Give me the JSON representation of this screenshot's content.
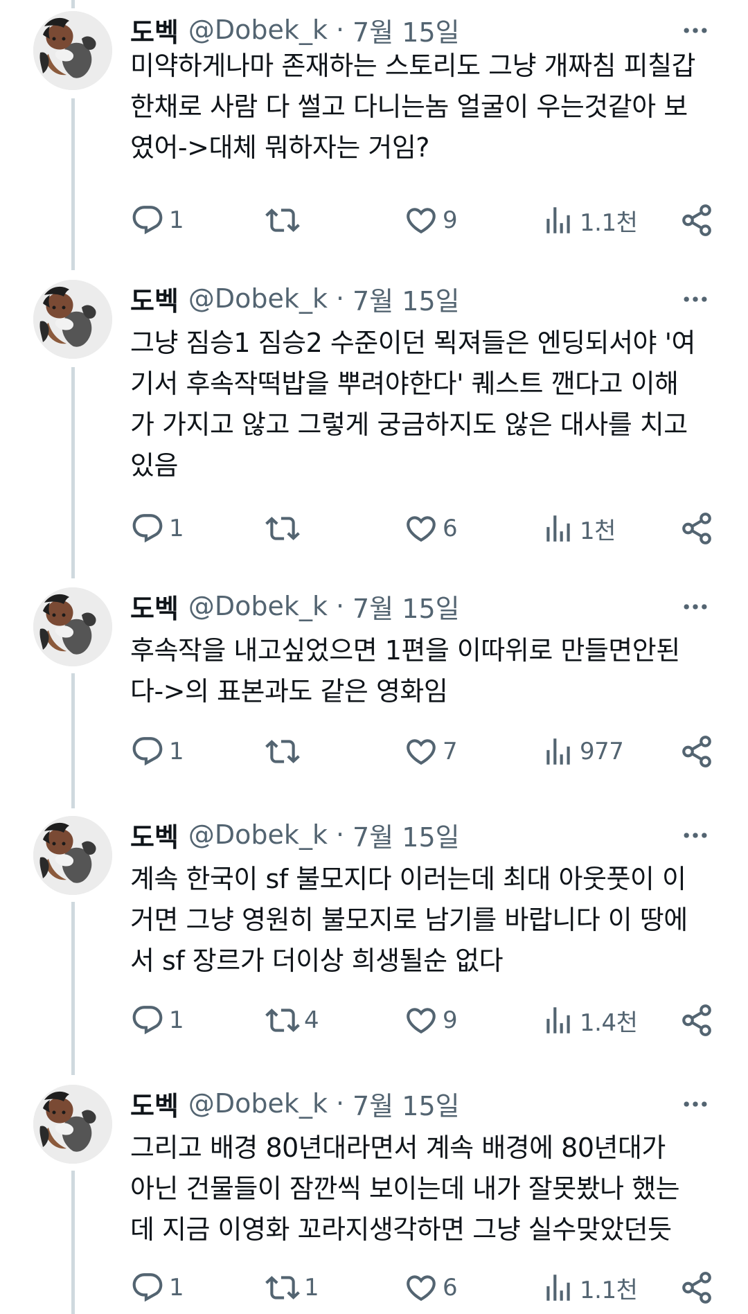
{
  "thread": {
    "tweets": [
      {
        "name": "도벡",
        "handle": "@Dobek_k",
        "separator": "·",
        "date": "7월 15일",
        "text": "미약하게나마 존재하는 스토리도 그냥 개짜침 피칠갑\n한채로 사람 다 썰고 다니는놈 얼굴이 우는것같아 보\n였어->대체 뭐하자는 거임?",
        "replies": "1",
        "retweets": "",
        "likes": "9",
        "views": "1.1천"
      },
      {
        "name": "도벡",
        "handle": "@Dobek_k",
        "separator": "·",
        "date": "7월 15일",
        "text": "그냥 짐승1 짐승2 수준이던 뫽져들은 엔딩되서야 '여\n기서 후속작떡밥을 뿌려야한다' 퀘스트 깬다고 이해\n가 가지고 않고 그렇게 궁금하지도 않은 대사를 치고\n있음",
        "replies": "1",
        "retweets": "",
        "likes": "6",
        "views": "1천"
      },
      {
        "name": "도벡",
        "handle": "@Dobek_k",
        "separator": "·",
        "date": "7월 15일",
        "text": "후속작을 내고싶었으면 1편을 이따위로 만들면안된\n다->의 표본과도 같은 영화임",
        "replies": "1",
        "retweets": "",
        "likes": "7",
        "views": "977"
      },
      {
        "name": "도벡",
        "handle": "@Dobek_k",
        "separator": "·",
        "date": "7월 15일",
        "text": "계속 한국이 sf 불모지다 이러는데 최대 아웃풋이 이\n거면 그냥 영원히 불모지로 남기를 바랍니다 이 땅에\n서 sf 장르가 더이상 희생될순 없다",
        "replies": "1",
        "retweets": "4",
        "likes": "9",
        "views": "1.4천"
      },
      {
        "name": "도벡",
        "handle": "@Dobek_k",
        "separator": "·",
        "date": "7월 15일",
        "text": "그리고 배경 80년대라면서 계속 배경에 80년대가\n아닌 건물들이 잠깐씩 보이는데 내가 잘못봤나 했는\n데 지금 이영화 꼬라지생각하면 그냥 실수맞았던듯",
        "replies": "1",
        "retweets": "1",
        "likes": "6",
        "views": "1.1천"
      }
    ]
  },
  "colors": {
    "text": "#0f1419",
    "secondary": "#536471",
    "thread_line": "#cfd9de",
    "background": "#ffffff"
  },
  "icons": {
    "more": "more-icon",
    "reply": "reply-icon",
    "retweet": "retweet-icon",
    "like": "heart-icon",
    "views": "views-icon",
    "share": "share-icon"
  }
}
